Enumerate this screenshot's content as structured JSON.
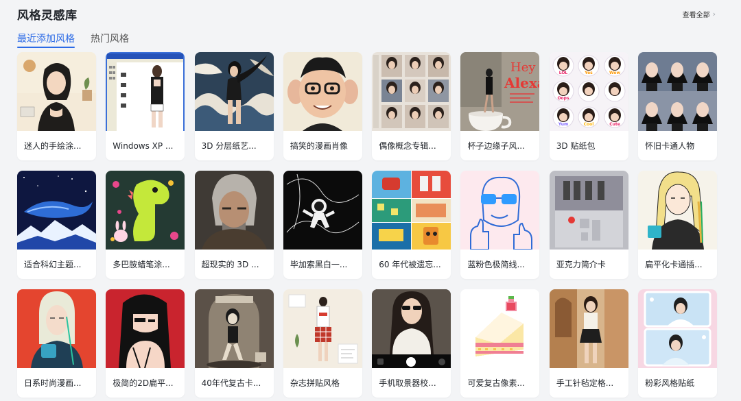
{
  "header": {
    "title": "风格灵感库",
    "view_all": "查看全部",
    "view_all_icon": "chevron-right-icon"
  },
  "tabs": [
    {
      "label": "最近添加风格",
      "active": true
    },
    {
      "label": "热门风格",
      "active": false
    }
  ],
  "cards": [
    {
      "label": "迷人的手绘涂...",
      "thumb": "sketch-woman-illustration"
    },
    {
      "label": "Windows XP ...",
      "thumb": "windows-xp-paint-window"
    },
    {
      "label": "3D 分层纸艺...",
      "thumb": "paper-layer-woman-waves"
    },
    {
      "label": "搞笑的漫画肖像",
      "thumb": "caricature-man-glasses"
    },
    {
      "label": "偶像概念专辑...",
      "thumb": "idol-photo-grid"
    },
    {
      "label": "杯子边缘子风...",
      "thumb": "tiny-woman-on-cup"
    },
    {
      "label": "3D 贴纸包",
      "thumb": "sticker-pack-grid"
    },
    {
      "label": "怀旧卡通人物",
      "thumb": "cartoon-girls-grid"
    },
    {
      "label": "适合科幻主题...",
      "thumb": "space-whale-night"
    },
    {
      "label": "多巴胺蜡笔涂...",
      "thumb": "crayon-dinosaur-bunny"
    },
    {
      "label": "超现实的 3D ...",
      "thumb": "realistic-warrior-portrait"
    },
    {
      "label": "毕加索黑白一...",
      "thumb": "line-art-astronaut"
    },
    {
      "label": "60 年代被遗忘...",
      "thumb": "sixties-cartoon-collage"
    },
    {
      "label": "蓝粉色极简线...",
      "thumb": "blue-line-thumbs-up"
    },
    {
      "label": "亚克力简介卡",
      "thumb": "acrylic-card"
    },
    {
      "label": "扁平化卡通插...",
      "thumb": "flat-girl-coffee"
    },
    {
      "label": "日系时尚漫画...",
      "thumb": "japanese-fashion-girl"
    },
    {
      "label": "极简的2D扁平...",
      "thumb": "minimal-2d-girl"
    },
    {
      "label": "40年代复古卡...",
      "thumb": "forties-vintage-cartoon"
    },
    {
      "label": "杂志拼贴风格",
      "thumb": "magazine-collage-fashion"
    },
    {
      "label": "手机取景器校...",
      "thumb": "phone-viewfinder-photo"
    },
    {
      "label": "可爱复古像素...",
      "thumb": "pixel-strawberry-cake"
    },
    {
      "label": "手工针毡定格...",
      "thumb": "felt-doll-street"
    },
    {
      "label": "粉彩风格贴纸",
      "thumb": "pastel-photo-stickers"
    }
  ],
  "window_text": {
    "hey": "Hey",
    "alexa": "Alexa!",
    "stickers": [
      "LOL",
      "Yes",
      "Wow",
      "Oops",
      "Yum",
      "Cool",
      "Cute"
    ]
  },
  "colors": {
    "accent": "#2b6ae6",
    "background": "#f3f4f6",
    "card": "#ffffff"
  }
}
